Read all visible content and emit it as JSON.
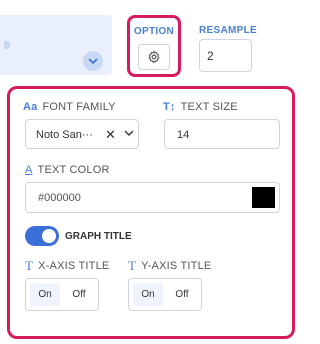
{
  "option": {
    "label": "OPTION",
    "icon": "gear-icon"
  },
  "resample": {
    "label": "RESAMPLE",
    "value": "2"
  },
  "panel": {
    "font_family": {
      "icon": "Aa",
      "label": "FONT FAMILY",
      "value": "Noto San···"
    },
    "text_size": {
      "icon": "T↕",
      "label": "TEXT SIZE",
      "value": "14"
    },
    "text_color": {
      "icon": "A",
      "label": "TEXT COLOR",
      "value": "#000000",
      "swatch_color": "#000000"
    },
    "graph_title": {
      "label": "GRAPH TITLE",
      "enabled": true
    },
    "x_axis_title": {
      "icon": "T",
      "label": "X-AXIS TITLE",
      "on": "On",
      "off": "Off",
      "selected": "On"
    },
    "y_axis_title": {
      "icon": "T",
      "label": "Y-AXIS TITLE",
      "on": "On",
      "off": "Off",
      "selected": "On"
    }
  },
  "colors": {
    "highlight": "#d81b60",
    "accent": "#4a7fd4",
    "toggle": "#3b6fd8"
  }
}
